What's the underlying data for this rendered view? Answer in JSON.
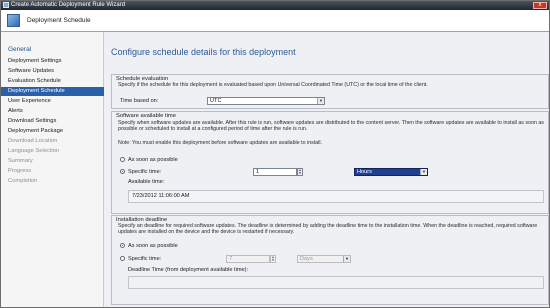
{
  "window": {
    "title": "Create Automatic Deployment Rule Wizard",
    "close_glyph": "x"
  },
  "header": {
    "title": "Deployment Schedule"
  },
  "sidebar": {
    "heading": "General",
    "items": [
      {
        "label": "Deployment Settings"
      },
      {
        "label": "Software Updates"
      },
      {
        "label": "Evaluation Schedule"
      },
      {
        "label": "Deployment Schedule"
      },
      {
        "label": "User Experience"
      },
      {
        "label": "Alerts"
      },
      {
        "label": "Download Settings"
      },
      {
        "label": "Deployment Package"
      },
      {
        "label": "Download Location"
      },
      {
        "label": "Language Selection"
      },
      {
        "label": "Summary"
      },
      {
        "label": "Progress"
      },
      {
        "label": "Completion"
      }
    ]
  },
  "main": {
    "title": "Configure schedule details for this deployment",
    "schedule_evaluation": {
      "legend": "Schedule evaluation",
      "description": "Specify if the schedule for this deployment is evaluated based upon Universal Coordinated Time (UTC) or the local time of the client.",
      "time_based_on_label": "Time based on:",
      "time_based_on_value": "UTC"
    },
    "software_available_time": {
      "legend": "Software available time",
      "description_1": "Specify when software updates are available. After this rule is run, software updates are distributed to the content server. Then the software updates are available to install as soon as possible or scheduled to install at a configured period of time after the rule is run.",
      "description_2": "Note: You must enable this deployment before software updates are available to install.",
      "asap_label": "As soon as possible",
      "specific_time_label": "Specific time:",
      "specific_time_value": "1",
      "unit_value": "Hours",
      "available_time_label": "Available time:",
      "available_time_value": "7/23/2012 11:06:00 AM"
    },
    "installation_deadline": {
      "legend": "Installation deadline",
      "description": "Specify an deadline for required software updates. The deadline is determined by adding the deadline time to the installation time. When the deadline is reached, required software updates are installed on the device and the device is restarted if necessary.",
      "asap_label": "As soon as possible",
      "specific_time_label": "Specific time:",
      "specific_time_value": "7",
      "unit_value": "Days",
      "deadline_time_label": "Deadline Time (from deployment available time):"
    }
  },
  "colors": {
    "title_blue": "#2d5a98",
    "nav_active": "#2b5fa8",
    "dropdown_highlight": "#1f3f8f"
  }
}
